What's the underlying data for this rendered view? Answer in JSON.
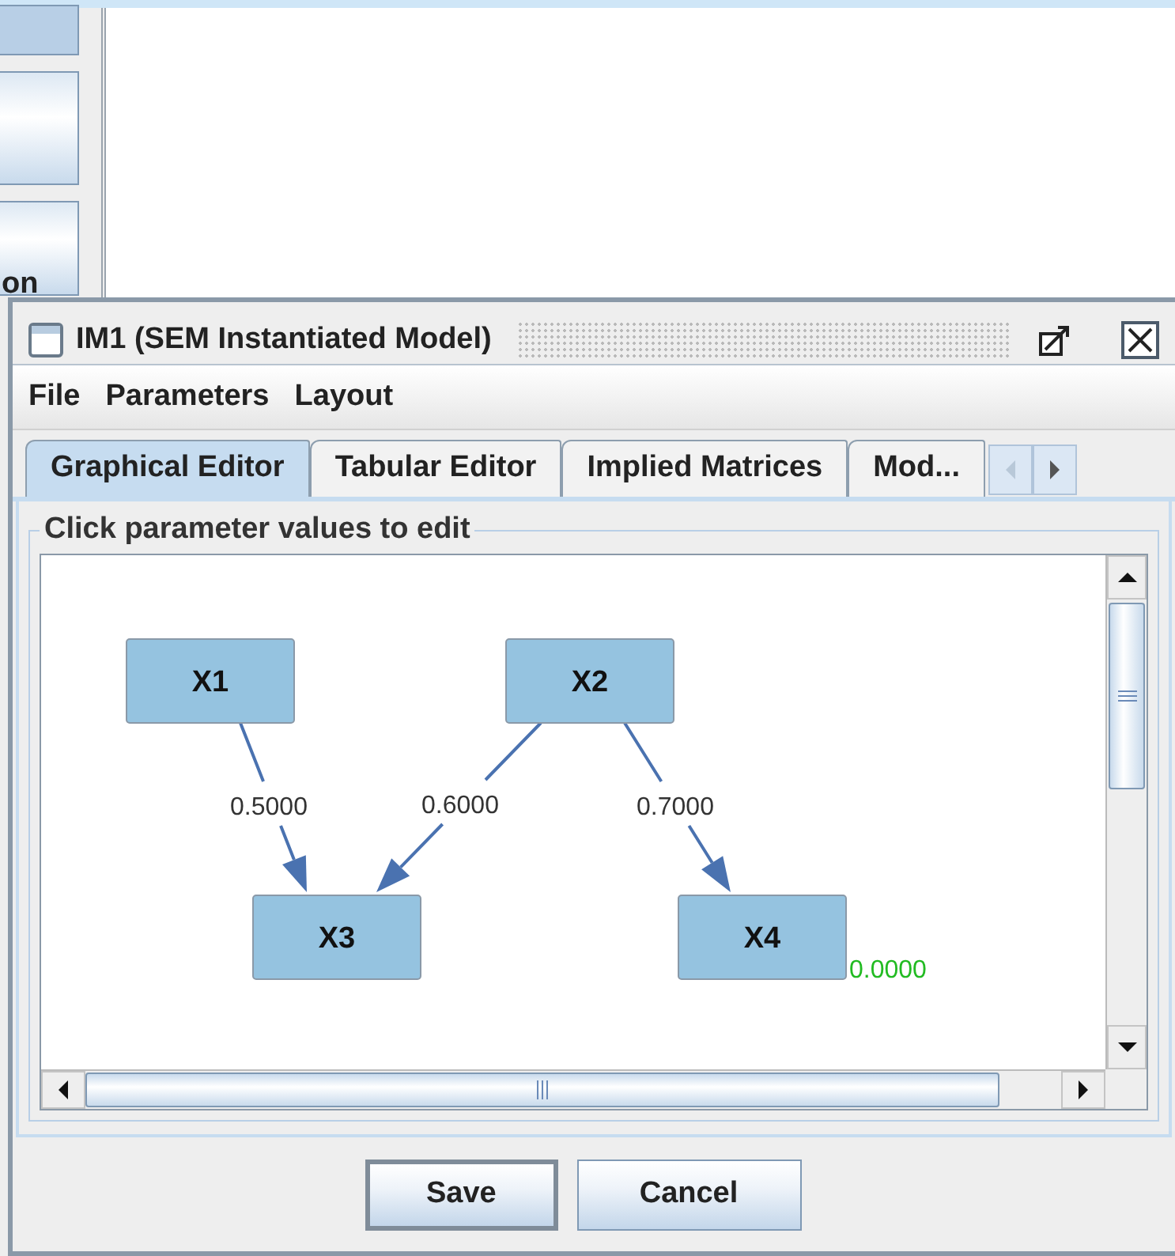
{
  "background": {
    "button_text": "on"
  },
  "window": {
    "title": "IM1 (SEM Instantiated Model)"
  },
  "menu": [
    "File",
    "Parameters",
    "Layout"
  ],
  "tabs": [
    {
      "label": "Graphical Editor",
      "selected": true
    },
    {
      "label": "Tabular Editor",
      "selected": false
    },
    {
      "label": "Implied Matrices",
      "selected": false
    },
    {
      "label": "Mod...",
      "selected": false
    }
  ],
  "group_title": "Click parameter values to edit",
  "graph": {
    "nodes": [
      {
        "label": "X1"
      },
      {
        "label": "X2"
      },
      {
        "label": "X3"
      },
      {
        "label": "X4"
      }
    ],
    "edges": [
      {
        "weight": "0.5000"
      },
      {
        "weight": "0.6000"
      },
      {
        "weight": "0.7000"
      }
    ],
    "error_terms": [
      {
        "value": "0.0000"
      }
    ]
  },
  "buttons": [
    {
      "label": "Save",
      "default": true
    },
    {
      "label": "Cancel",
      "default": false
    }
  ]
}
